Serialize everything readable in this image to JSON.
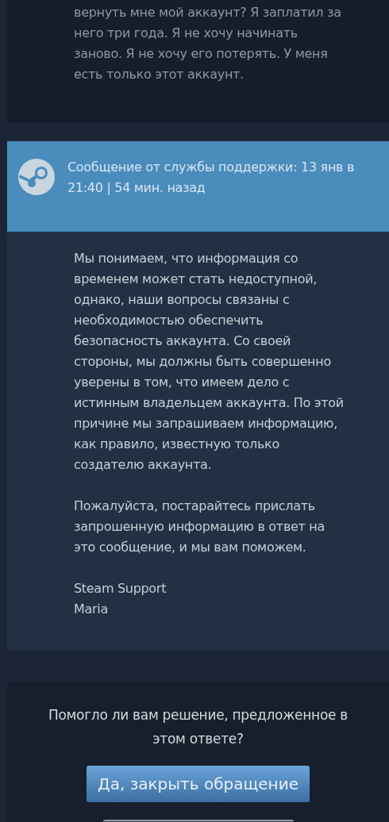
{
  "user_message": {
    "text": "вернуть мне мой аккаунт? Я заплатил за\nнего три года. Я не хочу начинать\nзаново. Я не хочу его потерять. У меня\nесть только этот аккаунт."
  },
  "support_message": {
    "header": "Сообщение от службы поддержки: 13 янв в\n21:40 | 54 мин. назад",
    "paragraphs": [
      "Мы понимаем, что информация со\nвременем может стать недоступной,\nоднако, наши вопросы связаны с\nнеобходимостью обеспечить\nбезопасность аккаунта. Со своей\nстороны, мы должны быть совершенно\nуверены в том, что имеем дело с\nистинным владельцем аккаунта. По этой\nпричине мы запрашиваем информацию,\nкак правило, известную только\nсоздателю аккаунта.",
      "Пожалуйста, постарайтесь прислать\nзапрошенную информацию в ответ на\nэто сообщение, и мы вам поможем.",
      "Steam Support\nMaria"
    ]
  },
  "feedback": {
    "question": "Помогло ли вам решение, предложенное в\nэтом ответе?",
    "buttons": [
      {
        "kind": "primary",
        "label": "Да, закрыть обращение"
      },
      {
        "kind": "secondary"
      }
    ]
  }
}
